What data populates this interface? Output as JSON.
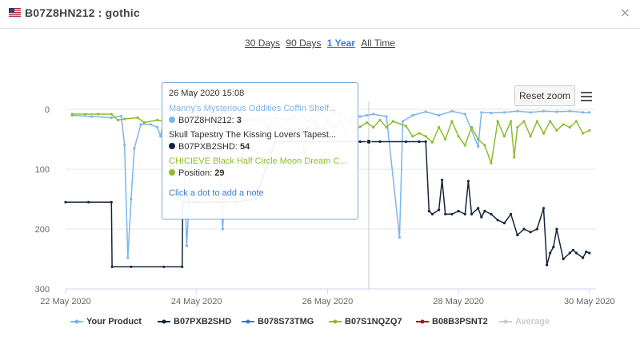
{
  "header": {
    "title": "B07Z8HN212 : gothic",
    "close_glyph": "×",
    "flag_icon": "us-flag-icon"
  },
  "ranges": [
    {
      "label": "30 Days",
      "active": false
    },
    {
      "label": "90 Days",
      "active": false
    },
    {
      "label": "1 Year",
      "active": true
    },
    {
      "label": "All Time",
      "active": false
    }
  ],
  "toolbar": {
    "reset_zoom": "Reset zoom",
    "menu_icon": "hamburger-menu-icon"
  },
  "tooltip": {
    "date": "26 May 2020 15:08",
    "rows": [
      {
        "name": "Manny's Mysterious Oddities Coffin Shelf...",
        "label": "B07Z8HN212:",
        "value": "3",
        "color": "#7cb5ec"
      },
      {
        "name": "Skull Tapestry The Kissing Lovers Tapest...",
        "label": "B07PXB2SHD:",
        "value": "54",
        "color": "#14243d"
      },
      {
        "name": "CHICIEVE Black Half Circle Moon Dream Ca...",
        "label": "Position:",
        "value": "29",
        "color": "#8fbc2b"
      }
    ],
    "note": "Click a dot to add a note"
  },
  "legend": [
    {
      "label": "Your Product",
      "color": "#7cb5ec",
      "hidden": false
    },
    {
      "label": "B07PXB2SHD",
      "color": "#14243d",
      "hidden": false
    },
    {
      "label": "B078S73TMG",
      "color": "#3a7bd5",
      "hidden": false
    },
    {
      "label": "B07S1NQZQ7",
      "color": "#8fbc2b",
      "hidden": false
    },
    {
      "label": "B08B3PSNT2",
      "color": "#a31515",
      "hidden": false
    },
    {
      "label": "Average",
      "color": "#cccccc",
      "hidden": true
    }
  ],
  "chart_data": {
    "type": "line",
    "y_reversed": true,
    "ylim": [
      0,
      300
    ],
    "y_ticks": [
      "0",
      "100",
      "200",
      "300"
    ],
    "x_range_days": [
      "2020-05-22",
      "2020-05-30"
    ],
    "x_ticks": [
      "22 May 2020",
      "24 May 2020",
      "26 May 2020",
      "28 May 2020",
      "30 May 2020"
    ],
    "crosshair_date": "26 May 2020 15:08",
    "series": [
      {
        "name": "Your Product",
        "color": "#7cb5ec",
        "points": [
          [
            0.1,
            10
          ],
          [
            0.4,
            12
          ],
          [
            0.7,
            14
          ],
          [
            0.85,
            11
          ],
          [
            0.9,
            60
          ],
          [
            0.95,
            248
          ],
          [
            1.0,
            150
          ],
          [
            1.05,
            65
          ],
          [
            1.15,
            25
          ],
          [
            1.3,
            25
          ],
          [
            1.4,
            30
          ],
          [
            1.45,
            45
          ],
          [
            1.5,
            16
          ],
          [
            1.6,
            40
          ],
          [
            1.7,
            50
          ],
          [
            1.75,
            70
          ],
          [
            1.8,
            60
          ],
          [
            1.85,
            228
          ],
          [
            1.9,
            120
          ],
          [
            1.95,
            60
          ],
          [
            2.05,
            30
          ],
          [
            2.15,
            90
          ],
          [
            2.2,
            48
          ],
          [
            2.3,
            60
          ],
          [
            2.35,
            120
          ],
          [
            2.4,
            200
          ],
          [
            2.45,
            100
          ],
          [
            2.6,
            30
          ],
          [
            2.8,
            16
          ],
          [
            3.0,
            16
          ],
          [
            3.2,
            14
          ],
          [
            3.4,
            18
          ],
          [
            3.55,
            5
          ],
          [
            3.7,
            20
          ],
          [
            3.8,
            10
          ],
          [
            3.9,
            6
          ],
          [
            4.0,
            15
          ],
          [
            4.1,
            5
          ],
          [
            4.2,
            10
          ],
          [
            4.35,
            22
          ],
          [
            4.4,
            8
          ],
          [
            4.5,
            12
          ],
          [
            4.6,
            10
          ],
          [
            4.7,
            8
          ],
          [
            4.9,
            12
          ],
          [
            5.1,
            214
          ],
          [
            5.15,
            20
          ],
          [
            5.3,
            10
          ],
          [
            5.5,
            4
          ],
          [
            5.7,
            10
          ],
          [
            5.9,
            3
          ],
          [
            6.1,
            8
          ],
          [
            6.3,
            62
          ],
          [
            6.35,
            5
          ],
          [
            6.5,
            6
          ],
          [
            6.7,
            5
          ],
          [
            6.9,
            3
          ],
          [
            7.1,
            5
          ],
          [
            7.3,
            3
          ],
          [
            7.5,
            4
          ],
          [
            7.7,
            3
          ],
          [
            7.9,
            5
          ],
          [
            8.0,
            5
          ]
        ]
      },
      {
        "name": "B07PXB2SHD",
        "color": "#14243d",
        "points": [
          [
            0.0,
            155
          ],
          [
            0.35,
            155
          ],
          [
            0.7,
            155
          ],
          [
            0.71,
            263
          ],
          [
            1.0,
            263
          ],
          [
            1.5,
            263
          ],
          [
            1.78,
            263
          ],
          [
            1.79,
            155
          ],
          [
            2.0,
            155
          ],
          [
            2.3,
            155
          ],
          [
            2.6,
            155
          ],
          [
            2.9,
            150
          ],
          [
            3.2,
            54
          ],
          [
            4.1,
            54
          ],
          [
            4.5,
            54
          ],
          [
            4.8,
            54
          ],
          [
            5.2,
            54
          ],
          [
            5.4,
            54
          ],
          [
            5.5,
            54
          ],
          [
            5.55,
            170
          ],
          [
            5.6,
            175
          ],
          [
            5.7,
            168
          ],
          [
            5.75,
            118
          ],
          [
            5.8,
            175
          ],
          [
            5.9,
            175
          ],
          [
            6.0,
            170
          ],
          [
            6.1,
            175
          ],
          [
            6.15,
            120
          ],
          [
            6.2,
            175
          ],
          [
            6.3,
            165
          ],
          [
            6.35,
            180
          ],
          [
            6.4,
            170
          ],
          [
            6.5,
            175
          ],
          [
            6.6,
            185
          ],
          [
            6.7,
            190
          ],
          [
            6.8,
            175
          ],
          [
            6.9,
            210
          ],
          [
            7.0,
            200
          ],
          [
            7.1,
            205
          ],
          [
            7.2,
            200
          ],
          [
            7.3,
            165
          ],
          [
            7.35,
            260
          ],
          [
            7.4,
            240
          ],
          [
            7.45,
            230
          ],
          [
            7.5,
            200
          ],
          [
            7.6,
            250
          ],
          [
            7.7,
            240
          ],
          [
            7.75,
            235
          ],
          [
            7.8,
            240
          ],
          [
            7.9,
            248
          ],
          [
            7.95,
            238
          ],
          [
            8.0,
            240
          ]
        ]
      },
      {
        "name": "B07S1NQZQ7",
        "color": "#8fbc2b",
        "points": [
          [
            0.1,
            8
          ],
          [
            0.3,
            8
          ],
          [
            0.5,
            8
          ],
          [
            0.7,
            8
          ],
          [
            0.8,
            18
          ],
          [
            0.9,
            16
          ],
          [
            1.1,
            14
          ],
          [
            1.2,
            22
          ],
          [
            1.4,
            18
          ],
          [
            1.6,
            22
          ],
          [
            1.8,
            20
          ],
          [
            2.0,
            20
          ],
          [
            2.2,
            18
          ],
          [
            2.5,
            22
          ],
          [
            2.8,
            18
          ],
          [
            3.0,
            20
          ],
          [
            3.1,
            30
          ],
          [
            3.2,
            14
          ],
          [
            3.3,
            30
          ],
          [
            3.4,
            18
          ],
          [
            3.5,
            12
          ],
          [
            3.6,
            25
          ],
          [
            3.65,
            80
          ],
          [
            3.7,
            30
          ],
          [
            3.8,
            20
          ],
          [
            3.9,
            35
          ],
          [
            4.0,
            20
          ],
          [
            4.1,
            30
          ],
          [
            4.2,
            20
          ],
          [
            4.3,
            40
          ],
          [
            4.5,
            29
          ],
          [
            4.6,
            22
          ],
          [
            4.7,
            30
          ],
          [
            4.8,
            18
          ],
          [
            4.9,
            30
          ],
          [
            5.0,
            20
          ],
          [
            5.2,
            28
          ],
          [
            5.3,
            45
          ],
          [
            5.4,
            40
          ],
          [
            5.5,
            45
          ],
          [
            5.6,
            55
          ],
          [
            5.7,
            30
          ],
          [
            5.8,
            50
          ],
          [
            5.9,
            20
          ],
          [
            6.0,
            45
          ],
          [
            6.1,
            60
          ],
          [
            6.2,
            30
          ],
          [
            6.3,
            50
          ],
          [
            6.4,
            60
          ],
          [
            6.5,
            90
          ],
          [
            6.6,
            20
          ],
          [
            6.7,
            45
          ],
          [
            6.8,
            20
          ],
          [
            6.85,
            80
          ],
          [
            6.9,
            30
          ],
          [
            7.0,
            20
          ],
          [
            7.1,
            45
          ],
          [
            7.2,
            20
          ],
          [
            7.3,
            40
          ],
          [
            7.4,
            20
          ],
          [
            7.5,
            35
          ],
          [
            7.6,
            25
          ],
          [
            7.7,
            30
          ],
          [
            7.8,
            20
          ],
          [
            7.9,
            40
          ],
          [
            8.0,
            35
          ]
        ]
      }
    ]
  }
}
